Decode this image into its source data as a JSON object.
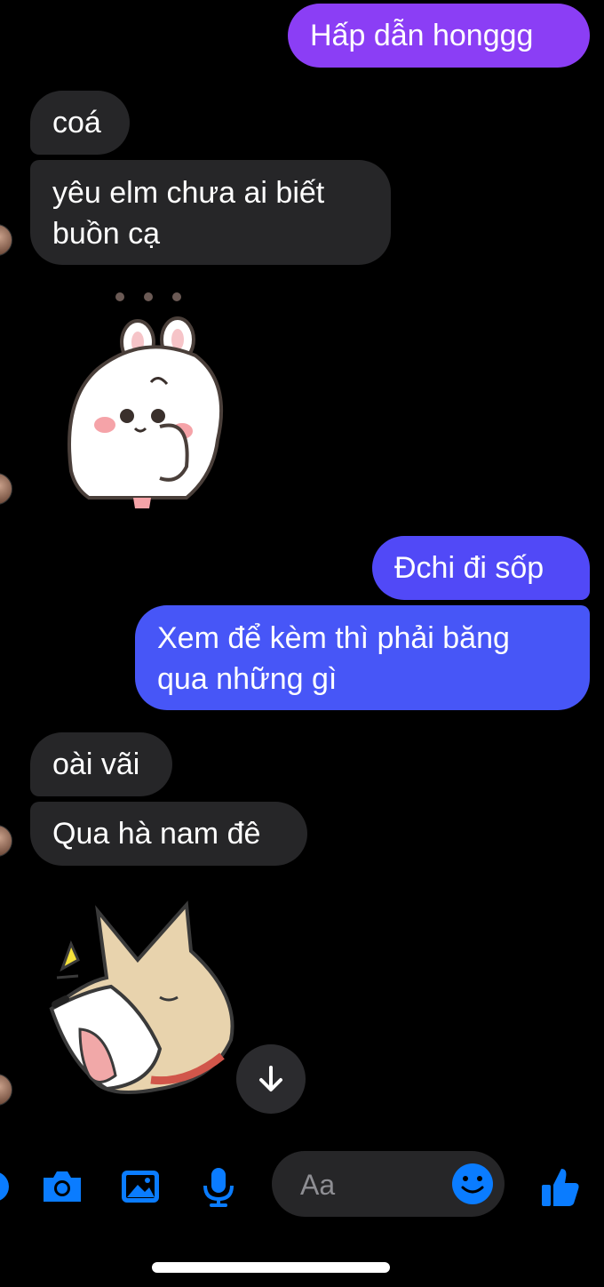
{
  "messages": [
    {
      "id": "m1",
      "direction": "outgoing",
      "text": "Hấp dẫn honggg"
    },
    {
      "id": "m2",
      "direction": "incoming",
      "text": "coá"
    },
    {
      "id": "m3",
      "direction": "incoming",
      "text": "yêu elm chưa ai biết buồn cạ"
    },
    {
      "id": "m4",
      "direction": "incoming",
      "type": "sticker",
      "sticker": "bunny-thinking-sticker"
    },
    {
      "id": "m5",
      "direction": "outgoing",
      "text": "Đchi đi sốp"
    },
    {
      "id": "m6",
      "direction": "outgoing",
      "text": "Xem để kèm thì phải băng qua những gì"
    },
    {
      "id": "m7",
      "direction": "incoming",
      "text": "oài vãi"
    },
    {
      "id": "m8",
      "direction": "incoming",
      "text": "Qua hà nam đê"
    },
    {
      "id": "m9",
      "direction": "incoming",
      "type": "sticker",
      "sticker": "shiba-yawning-sticker"
    }
  ],
  "composer": {
    "placeholder": "Aa",
    "icons": [
      "camera-icon",
      "gallery-icon",
      "microphone-icon",
      "emoji-icon",
      "like-icon"
    ]
  },
  "scroll_button": {
    "icon": "arrow-down-icon"
  },
  "colors": {
    "background": "#000000",
    "incoming_bubble": "#262628",
    "outgoing_gradient_top": "#8b3ef5",
    "outgoing_gradient_bottom": "#3f5cf6",
    "accent": "#0a7cff"
  }
}
